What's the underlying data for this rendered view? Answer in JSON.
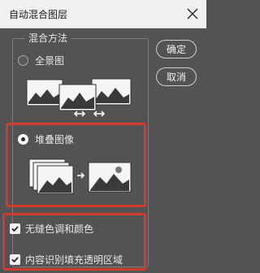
{
  "window": {
    "title": "自动混合图层"
  },
  "group": {
    "title": "混合方法"
  },
  "options": {
    "panorama_label": "全景图",
    "stack_label": "堆叠图像",
    "selected": "stack"
  },
  "checkboxes": {
    "seamless_label": "无缝色调和颜色",
    "seamless_checked": true,
    "content_aware_label": "内容识别填充透明区域",
    "content_aware_checked": true
  },
  "buttons": {
    "ok": "确定",
    "cancel": "取消"
  },
  "icons": {
    "close": "close-icon",
    "panorama": "panorama-illustration-icon",
    "stack": "stack-illustration-icon",
    "check": "check-icon"
  },
  "colors": {
    "background": "#535353",
    "titlebar": "#f0f0f0",
    "highlight_border": "#d33a2f"
  }
}
